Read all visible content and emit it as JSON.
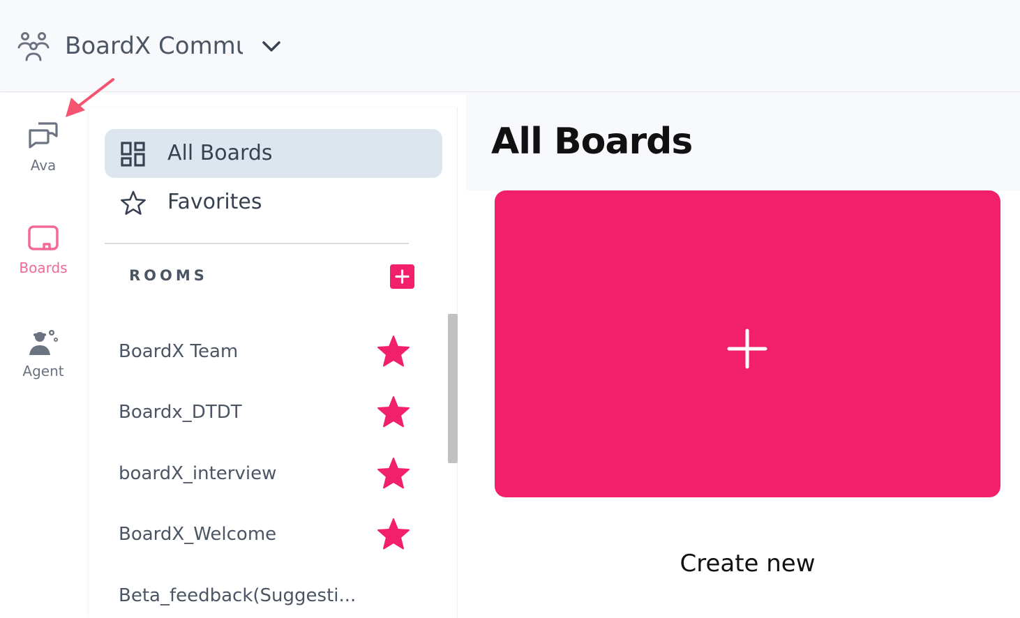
{
  "header": {
    "team_name": "BoardX Commu"
  },
  "rail": {
    "items": [
      {
        "label": "Ava",
        "icon": "chat-bubbles-icon"
      },
      {
        "label": "Boards",
        "icon": "board-icon"
      },
      {
        "label": "Agent",
        "icon": "agent-gear-icon"
      }
    ],
    "active": "Boards"
  },
  "panel": {
    "nav": [
      {
        "label": "All Boards",
        "icon": "grid-icon",
        "active": true
      },
      {
        "label": "Favorites",
        "icon": "star-outline-icon",
        "active": false
      }
    ],
    "rooms_title": "ROOMS",
    "rooms": [
      {
        "name": "BoardX Team",
        "favorite": true
      },
      {
        "name": "Boardx_DTDT",
        "favorite": true
      },
      {
        "name": "boardX_interview",
        "favorite": true
      },
      {
        "name": "BoardX_Welcome",
        "favorite": true
      },
      {
        "name": "Beta_feedback(Suggesti...",
        "favorite": false
      }
    ]
  },
  "main": {
    "title": "All Boards",
    "create_label": "Create new"
  },
  "colors": {
    "accent": "#f21f6b",
    "active_rail": "#f06a95",
    "nav_active_bg": "#dde6ee",
    "annotation_arrow": "#f4546f"
  }
}
